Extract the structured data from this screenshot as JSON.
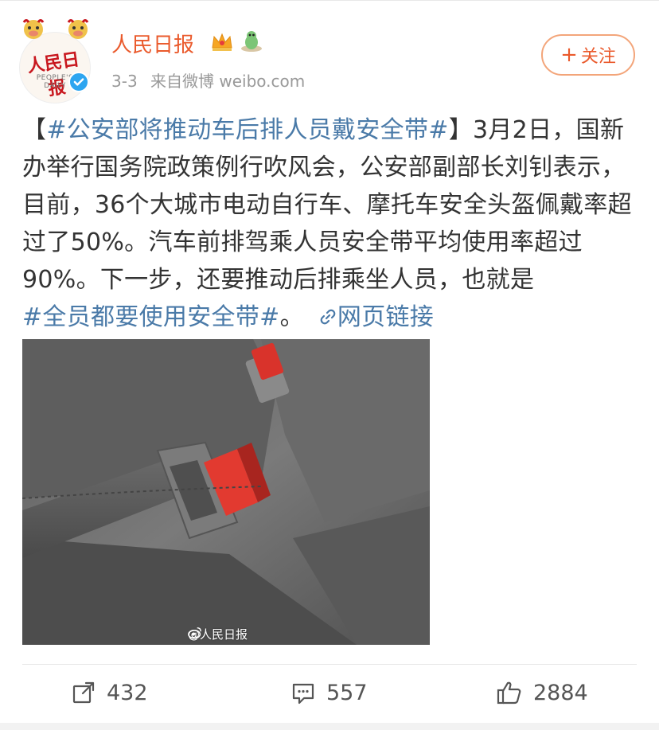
{
  "account": {
    "name": "人民日报",
    "logo_text": "人民日报",
    "logo_sub": "PEOPLE'S DAILY",
    "date": "3-3",
    "source": "来自微博 weibo.com",
    "avatar_icon": "people-daily-logo",
    "badge_icon": "verified-badge-icon",
    "crown_icon": "crown-icon",
    "dino_icon": "dinosaur-icon"
  },
  "follow_button": {
    "plus": "+",
    "label": "关注"
  },
  "post": {
    "open_bracket": "【",
    "topic1": "#公安部将推动车后排人员戴安全带#",
    "close_bracket": "】",
    "body": "3月2日，国新办举行国务院政策例行吹风会，公安部副部长刘钊表示，目前，36个大城市电动自行车、摩托车安全头盔佩戴率超过了50%。汽车前排驾乘人员安全带平均使用率超过90%。下一步，还要推动后排乘坐人员，也就是",
    "topic2": "#全员都要使用安全带#",
    "end": "。",
    "link_icon": "link-icon",
    "link_label": "网页链接"
  },
  "photo": {
    "watermark": "@人民日报",
    "watermark_icon": "weibo-icon"
  },
  "actions": {
    "share_count": "432",
    "comment_count": "557",
    "like_count": "2884",
    "share_icon": "share-icon",
    "comment_icon": "comment-icon",
    "like_icon": "thumbs-up-icon"
  },
  "colors": {
    "name": "#ea5a2c",
    "topic": "#4a7aa8",
    "follow_border": "#f3a57a",
    "meta": "#999999",
    "verified": "#2da5f0"
  }
}
